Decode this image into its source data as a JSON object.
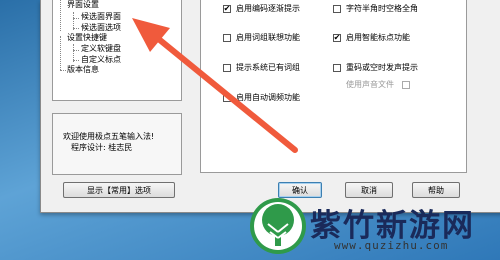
{
  "tree": {
    "items": [
      {
        "label": "界面设置"
      },
      {
        "label": "候选面界面"
      },
      {
        "label": "候选面选项"
      },
      {
        "label": "设置快捷键"
      },
      {
        "label": "定义软键盘"
      },
      {
        "label": "自定义标点"
      },
      {
        "label": "版本信息"
      }
    ]
  },
  "welcome": {
    "line1": "欢迎使用极点五笔输入法!",
    "line2": "程序设计: 桂志民"
  },
  "buttons": {
    "display": "显示【常用】选项",
    "ok": "确认",
    "cancel": "取消",
    "help": "帮助"
  },
  "options": [
    {
      "label": "启用编码逐渐提示",
      "checked": true
    },
    {
      "label": "字符半角时空格全角",
      "checked": false
    },
    {
      "label": "启用词组联想功能",
      "checked": false
    },
    {
      "label": "启用智能标点功能",
      "checked": true
    },
    {
      "label": "提示系统已有词组",
      "checked": false
    },
    {
      "label": "重码或空时发声提示",
      "checked": false
    },
    {
      "label": "使用声音文件",
      "checked": false,
      "disabled": true
    },
    {
      "label": "启用自动调频功能",
      "checked": false
    }
  ],
  "check_mark": "✔",
  "watermark": {
    "brand": "紫竹新游网",
    "url": "www.quzizhu.com"
  },
  "colors": {
    "arrow": "#f05a3c",
    "logo_green": "#2f9a4a"
  }
}
